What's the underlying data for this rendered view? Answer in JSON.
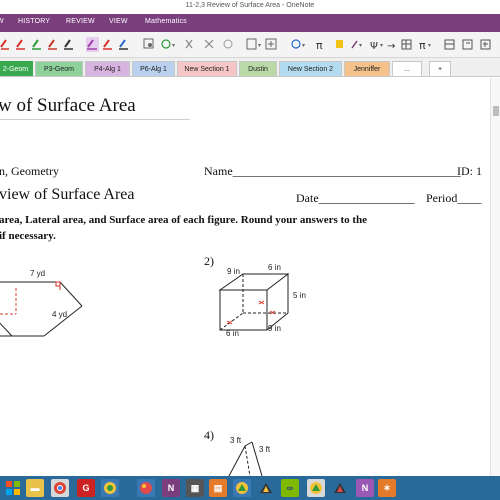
{
  "window": {
    "title": "11-2,3 Review of Surface Area - OneNote"
  },
  "menu": [
    "HISTORY",
    "REVIEW",
    "VIEW",
    "Mathematics"
  ],
  "sections": [
    {
      "label": "2-Geom",
      "color": "#3aa84f"
    },
    {
      "label": "P3-Geom",
      "color": "#8fd19b"
    },
    {
      "label": "P4-Alg 1",
      "color": "#d8b4e0"
    },
    {
      "label": "P6-Alg 1",
      "color": "#b9d0ef"
    },
    {
      "label": "New Section 1",
      "color": "#f6c6c6"
    },
    {
      "label": "Dustin",
      "color": "#b9d9a6"
    },
    {
      "label": "New Section 2",
      "color": "#b4dcf0"
    },
    {
      "label": "Jenniffer",
      "color": "#f4c28a"
    },
    {
      "label": "...",
      "color": "#ffffff"
    },
    {
      "label": "+",
      "color": "#ffffff"
    }
  ],
  "page": {
    "title": "w of Surface Area"
  },
  "worksheet": {
    "course": "n, Geometry",
    "name_label": "Name",
    "name_line": "______________________________________",
    "id_label": "ID: 1",
    "heading": "view of Surface Area",
    "date_label": "Date",
    "date_line": "________________",
    "period_label": "Period",
    "period_line": "____",
    "instructions_1": "area, Lateral area, and Surface area of each figure.  Round your answers to the",
    "instructions_2": "if necessary.",
    "problem2_number": "2)",
    "problem4_number": "4)"
  },
  "figures": {
    "fig1": {
      "top": "7 yd",
      "side": "4 yd"
    },
    "fig2": {
      "left_top": "9 in",
      "top": "6 in",
      "right": "5 in",
      "bottom_right": "9 in",
      "bottom_left": "6 in"
    },
    "fig4": {
      "left": "3 ft",
      "right": "3 ft"
    }
  },
  "icons": {
    "ribbon": [
      "pen-red-icon",
      "pen-red-icon",
      "pen-green-icon",
      "pen-red-icon",
      "pen-purple-icon",
      "pen-red-icon",
      "pen-black-icon",
      "pen-blue-icon",
      "lasso-icon",
      "shape-circle-icon",
      "eraser-x-icon",
      "shape-circle-icon",
      "insert-space-icon",
      "ink-to-text-icon",
      "math-icon",
      "pi-icon",
      "highlighter-icon",
      "pen-dropdown-icon",
      "math-symbols-icon",
      "arrow-icon",
      "grid-icon",
      "pi-menu-icon",
      "matrix-icon",
      "calculator-icon",
      "plus-box-icon"
    ],
    "taskbar": [
      "start-icon",
      "folder-icon",
      "chrome-icon",
      "media-icon",
      "onenote-icon",
      "trophy-icon",
      "paint-icon",
      "onenote-icon",
      "calculator-icon",
      "smartboard-icon",
      "glasses-icon",
      "camera-icon",
      "geogebra-icon",
      "word-icon",
      "onenote-icon",
      "flame-icon"
    ]
  }
}
